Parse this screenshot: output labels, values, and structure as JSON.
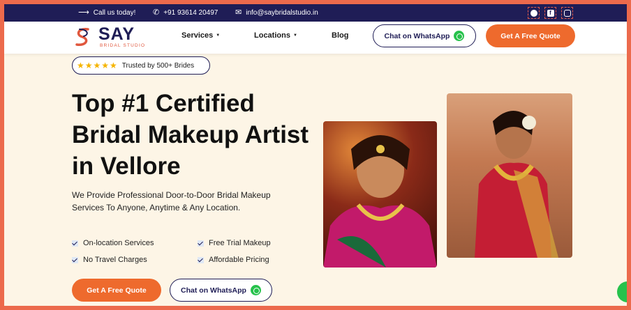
{
  "topbar": {
    "call_label": "Call us today!",
    "phone": "+91 93614 20497",
    "email": "info@saybridalstudio.in"
  },
  "brand": {
    "name": "SAY",
    "tagline": "BRIDAL STUDIO"
  },
  "nav": {
    "items": [
      {
        "label": "Services"
      },
      {
        "label": "Locations"
      },
      {
        "label": "Blog"
      }
    ],
    "whatsapp_label": "Chat on WhatsApp",
    "quote_label": "Get A Free Quote"
  },
  "hero": {
    "badge": "Trusted by 500+ Brides",
    "rating_stars": 5,
    "headline_lines": [
      "Top #1 Certified",
      "Bridal Makeup Artist",
      "in Vellore"
    ],
    "subtext": "We Provide Professional Door-to-Door Bridal Makeup Services To Anyone, Anytime & Any Location.",
    "features": [
      "On-location Services",
      "Free Trial Makeup",
      "No Travel Charges",
      "Affordable Pricing"
    ],
    "quote_label": "Get A Free Quote",
    "whatsapp_label": "Chat on WhatsApp"
  },
  "colors": {
    "navy": "#1f1d56",
    "accent": "#ee6a2d",
    "cream": "#fdf5e6",
    "whatsapp": "#27c24c"
  }
}
